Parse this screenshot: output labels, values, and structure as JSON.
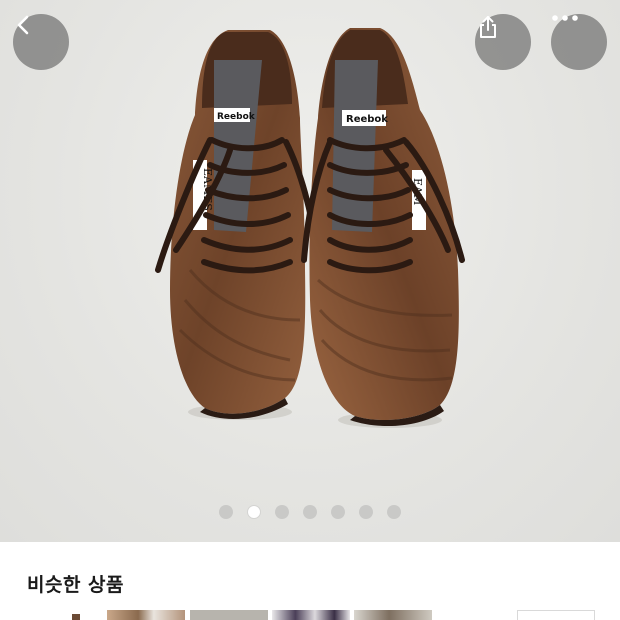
{
  "header": {
    "back_icon": "chevron-left-icon",
    "share_icon": "share-icon",
    "more_icon": "more-horizontal-icon"
  },
  "product_image": {
    "description_icon": "sneaker-photo",
    "shoe_brand_tag": "Reebok",
    "tongue_label_left": "EAMES",
    "tongue_label_right": "EAM",
    "colors": {
      "leather": "#7a4a2f",
      "laces": "#2b1a12",
      "background": "#e6e6e3"
    }
  },
  "carousel": {
    "total": 7,
    "active_index": 1
  },
  "similar": {
    "title": "비슷한 상품"
  }
}
